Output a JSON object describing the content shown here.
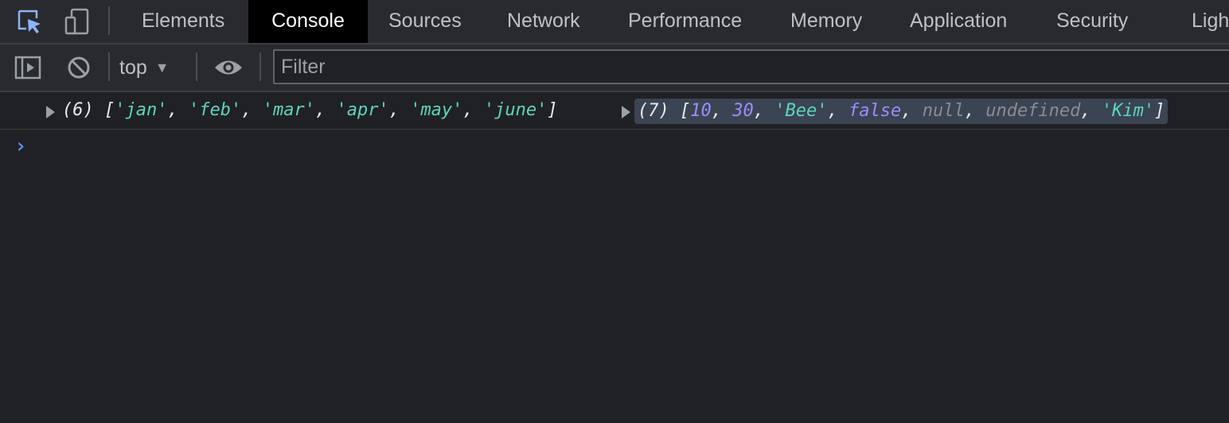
{
  "tabbar": {
    "icons": {
      "inspect": "inspect-element-icon",
      "device": "device-toolbar-icon"
    },
    "tabs": [
      {
        "label": "Elements"
      },
      {
        "label": "Console",
        "active": true
      },
      {
        "label": "Sources"
      },
      {
        "label": "Network"
      },
      {
        "label": "Performance"
      },
      {
        "label": "Memory"
      },
      {
        "label": "Application"
      },
      {
        "label": "Security"
      },
      {
        "label": "Ligh"
      }
    ]
  },
  "console_toolbar": {
    "icons": {
      "sidebar": "show-sidebar-icon",
      "clear": "clear-console-icon",
      "live_expression": "eye-icon"
    },
    "context": "top",
    "filter_placeholder": "Filter"
  },
  "log": {
    "array1": {
      "count": "(6)",
      "items": [
        "'jan'",
        "'feb'",
        "'mar'",
        "'apr'",
        "'may'",
        "'june'"
      ]
    },
    "array2": {
      "count": "(7)",
      "items": [
        "10",
        "30",
        "'Bee'",
        "false",
        "null",
        "undefined",
        "'Kim'"
      ]
    }
  },
  "prompt": {
    "symbol": "›"
  },
  "colors": {
    "accent": "#5b8ef5",
    "string": "#5cd5c0",
    "number": "#9d8cff",
    "nullish": "#8a8d92",
    "background": "#202124"
  }
}
